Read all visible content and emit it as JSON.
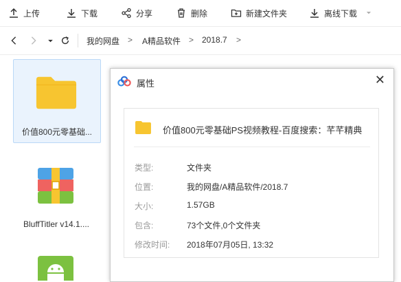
{
  "toolbar": {
    "upload": "上传",
    "download": "下载",
    "share": "分享",
    "delete": "删除",
    "new_folder": "新建文件夹",
    "offline_download": "离线下载"
  },
  "breadcrumb": {
    "root": "我的网盘",
    "level1": "A精品软件",
    "level2": "2018.7",
    "sep": ">"
  },
  "files": [
    {
      "name": "价值800元零基础...",
      "type": "folder"
    },
    {
      "name": "BluffTitler v14.1....",
      "type": "archive"
    },
    {
      "name": "",
      "type": "apk"
    }
  ],
  "dialog": {
    "title": "属性",
    "close": "✕",
    "file_name": "价值800元零基础PS视频教程-百度搜索：芊芊精典",
    "rows": [
      {
        "label": "类型:",
        "value": "文件夹"
      },
      {
        "label": "位置:",
        "value": "我的网盘/A精品软件/2018.7"
      },
      {
        "label": "大小:",
        "value": "1.57GB"
      },
      {
        "label": "包含:",
        "value": "73个文件,0个文件夹"
      },
      {
        "label": "修改时间:",
        "value": "2018年07月05日, 13:32"
      }
    ]
  },
  "colors": {
    "folder": "#f7c530",
    "accent": "#3a8ee6",
    "apk_green": "#7cc140",
    "selection_bg": "#eaf3fd"
  }
}
